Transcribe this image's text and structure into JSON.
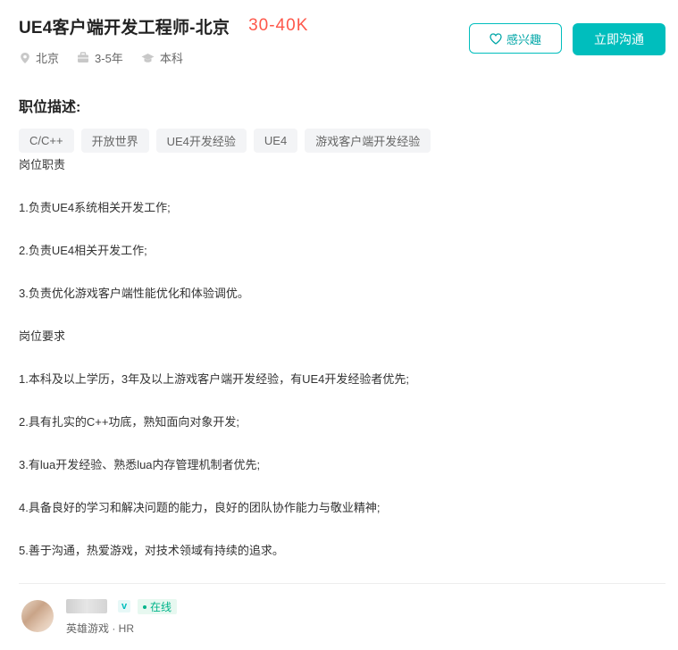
{
  "job": {
    "title": "UE4客户端开发工程师-北京",
    "salary": "30-40K",
    "location": "北京",
    "experience": "3-5年",
    "degree": "本科"
  },
  "actions": {
    "interest_label": "感兴趣",
    "chat_label": "立即沟通"
  },
  "description": {
    "section_title": "职位描述:",
    "tags": [
      "C/C++",
      "开放世界",
      "UE4开发经验",
      "UE4",
      "游戏客户端开发经验"
    ],
    "lines": [
      "岗位职责",
      "1.负责UE4系统相关开发工作;",
      "2.负责UE4相关开发工作;",
      "3.负责优化游戏客户端性能优化和体验调优。",
      "岗位要求",
      "1.本科及以上学历，3年及以上游戏客户端开发经验，有UE4开发经验者优先;",
      "2.具有扎实的C++功底，熟知面向对象开发;",
      "3.有lua开发经验、熟悉lua内存管理机制者优先;",
      "4.具备良好的学习和解决问题的能力，良好的团队协作能力与敬业精神;",
      "5.善于沟通，热爱游戏，对技术领域有持续的追求。"
    ]
  },
  "recruiter": {
    "verified_badge": "v",
    "status": "在线",
    "company_role": "英雄游戏 · HR"
  },
  "colors": {
    "accent": "#00bebd",
    "salary": "#fe574a",
    "online": "#00b38a"
  },
  "icons": [
    "location-icon",
    "briefcase-icon",
    "graduation-cap-icon",
    "heart-icon"
  ]
}
